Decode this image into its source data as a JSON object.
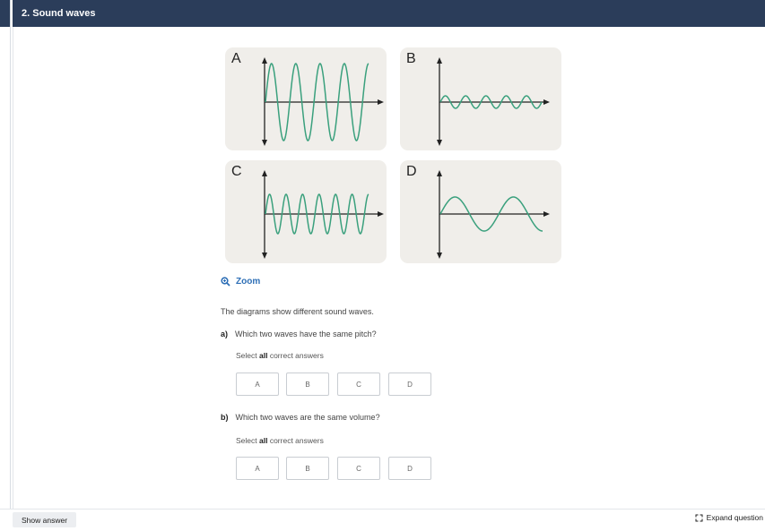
{
  "header": {
    "title": "2. Sound waves"
  },
  "diagrams": [
    {
      "letter": "A",
      "icon": "waveform-high-amplitude-medium-frequency"
    },
    {
      "letter": "B",
      "icon": "waveform-low-amplitude-medium-frequency"
    },
    {
      "letter": "C",
      "icon": "waveform-medium-amplitude-high-frequency"
    },
    {
      "letter": "D",
      "icon": "waveform-medium-amplitude-low-frequency"
    }
  ],
  "zoom": {
    "label": "Zoom",
    "icon": "zoom-icon"
  },
  "prompt": "The diagrams show different sound waves.",
  "questions": [
    {
      "part": "a)",
      "text": "Which two waves have the same pitch?",
      "instruction_prefix": "Select",
      "instruction_bold": "all",
      "instruction_suffix": "correct answers",
      "options": [
        "A",
        "B",
        "C",
        "D"
      ]
    },
    {
      "part": "b)",
      "text": "Which two waves are the same volume?",
      "instruction_prefix": "Select",
      "instruction_bold": "all",
      "instruction_suffix": "correct answers",
      "options": [
        "A",
        "B",
        "C",
        "D"
      ]
    }
  ],
  "footer": {
    "show_answer_label": "Show answer",
    "expand_label": "Expand question",
    "expand_icon": "expand-icon"
  },
  "colors": {
    "header_bg": "#2b3d5a",
    "wave": "#3aa07d",
    "panel_bg": "#f0eeea",
    "link": "#2e6fb6"
  }
}
